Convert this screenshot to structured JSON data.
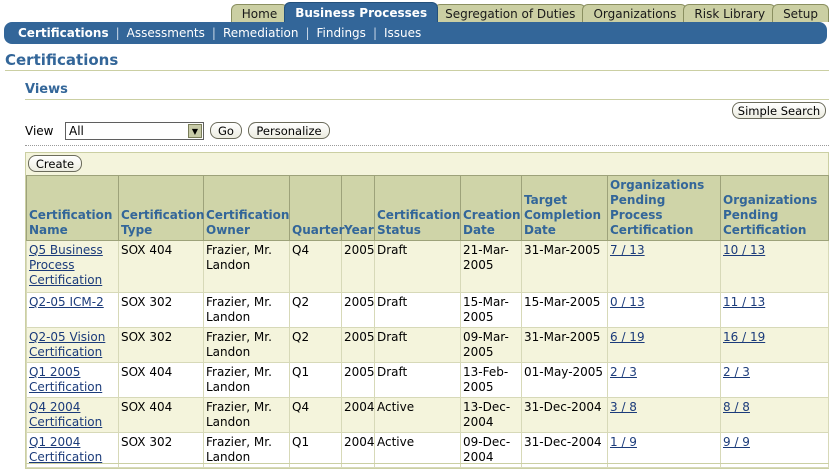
{
  "tabs": [
    {
      "label": "Home",
      "active": false
    },
    {
      "label": "Business Processes",
      "active": true
    },
    {
      "label": "Segregation of Duties",
      "active": false
    },
    {
      "label": "Organizations",
      "active": false
    },
    {
      "label": "Risk Library",
      "active": false
    },
    {
      "label": "Setup",
      "active": false
    }
  ],
  "subnav": [
    "Certifications",
    "Assessments",
    "Remediation",
    "Findings",
    "Issues"
  ],
  "page_title": "Certifications",
  "section_title": "Views",
  "simple_search": "Simple Search",
  "view": {
    "label": "View",
    "selected": "All",
    "go": "Go",
    "personalize": "Personalize"
  },
  "create": "Create",
  "columns": [
    "Certification Name",
    "Certification Type",
    "Certification Owner",
    "Quarter",
    "Year",
    "Certification Status",
    "Creation Date",
    "Target Completion Date",
    "Organizations Pending Process Certification",
    "Organizations Pending Certification"
  ],
  "rows": [
    {
      "name": "Q5 Business Process Certification",
      "type": "SOX 404",
      "owner": "Frazier, Mr. Landon",
      "quarter": "Q4",
      "year": "2005",
      "status": "Draft",
      "created": "21-Mar-2005",
      "target": "31-Mar-2005",
      "pending_process": "7 / 13",
      "pending_cert": "10 / 13"
    },
    {
      "name": "Q2-05 ICM-2",
      "type": "SOX 302",
      "owner": "Frazier, Mr. Landon",
      "quarter": "Q2",
      "year": "2005",
      "status": "Draft",
      "created": "15-Mar-2005",
      "target": "15-Mar-2005",
      "pending_process": "0 / 13",
      "pending_cert": "11 / 13"
    },
    {
      "name": "Q2-05 Vision Certification",
      "type": "SOX 302",
      "owner": "Frazier, Mr. Landon",
      "quarter": "Q2",
      "year": "2005",
      "status": "Draft",
      "created": "09-Mar-2005",
      "target": "31-Mar-2005",
      "pending_process": "6 / 19",
      "pending_cert": "16 / 19"
    },
    {
      "name": "Q1 2005 Certification",
      "type": "SOX 404",
      "owner": "Frazier, Mr. Landon",
      "quarter": "Q1",
      "year": "2005",
      "status": "Draft",
      "created": "13-Feb-2005",
      "target": "01-May-2005",
      "pending_process": "2 / 3",
      "pending_cert": "2 / 3"
    },
    {
      "name": "Q4 2004 Certification",
      "type": "SOX 404",
      "owner": "Frazier, Mr. Landon",
      "quarter": "Q4",
      "year": "2004",
      "status": "Active",
      "created": "13-Dec-2004",
      "target": "31-Dec-2004",
      "pending_process": "3 / 8",
      "pending_cert": "8 / 8"
    },
    {
      "name": "Q1 2004 Certification",
      "type": "SOX 302",
      "owner": "Frazier, Mr. Landon",
      "quarter": "Q1",
      "year": "2004",
      "status": "Active",
      "created": "09-Dec-2004",
      "target": "31-Dec-2004",
      "pending_process": "1 / 9",
      "pending_cert": "9 / 9"
    }
  ]
}
